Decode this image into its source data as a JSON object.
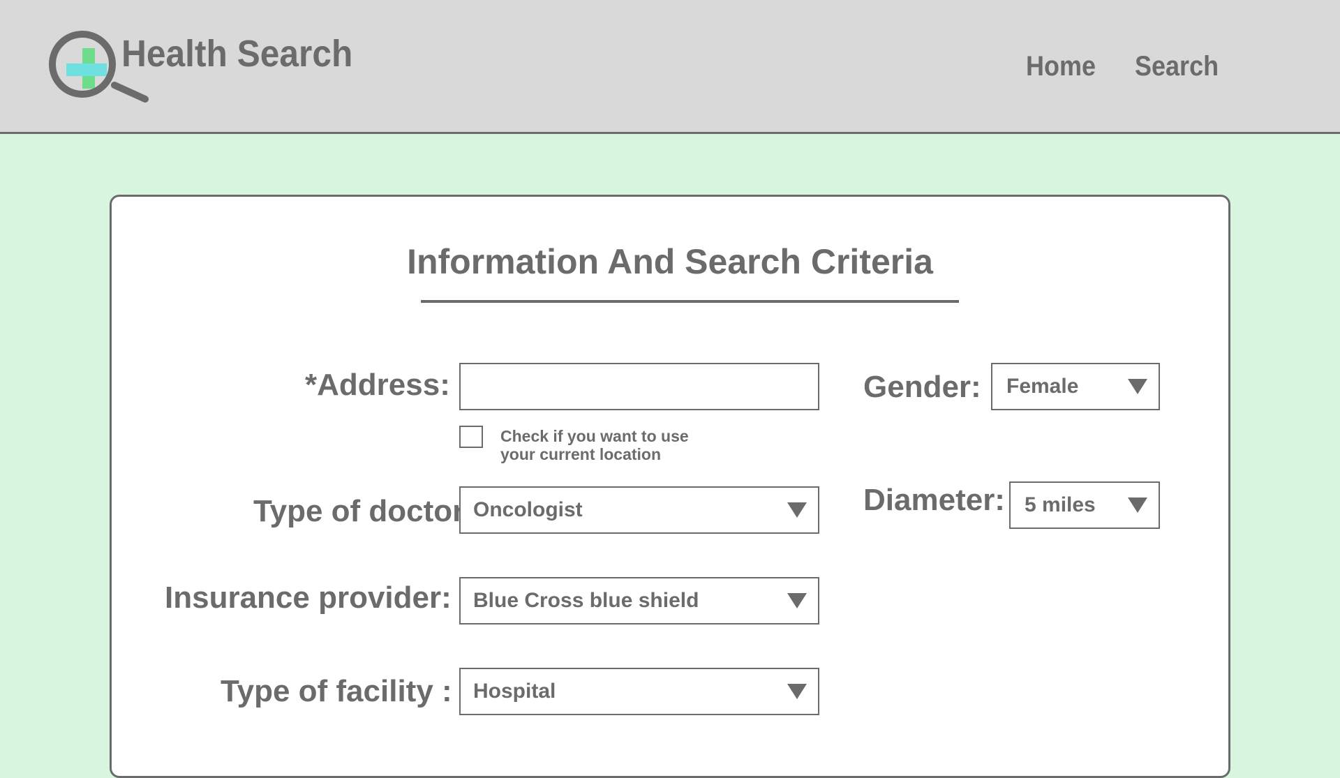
{
  "header": {
    "brand": "Health Search",
    "nav": {
      "home": "Home",
      "search": "Search"
    }
  },
  "form": {
    "title": "Information And Search Criteria",
    "address": {
      "label": "*Address:",
      "value": ""
    },
    "location_check": {
      "line1": "Check if you want to use",
      "line2": "your current location",
      "checked": false
    },
    "doctor": {
      "label": "Type of doctor:",
      "value": "Oncologist"
    },
    "insurance": {
      "label": "Insurance provider:",
      "value": "Blue Cross blue shield"
    },
    "facility": {
      "label": "Type of facility :",
      "value": "Hospital"
    },
    "gender": {
      "label": "Gender:",
      "value": "Female"
    },
    "diameter": {
      "label": "Diameter:",
      "value": "5 miles"
    }
  },
  "colors": {
    "page_bg": "#d8f5df",
    "header_bg": "#d9d9d9",
    "text": "#6b6b6b",
    "logo_cross_green": "#6edc8a",
    "logo_cross_cyan": "#6fe0e0"
  }
}
